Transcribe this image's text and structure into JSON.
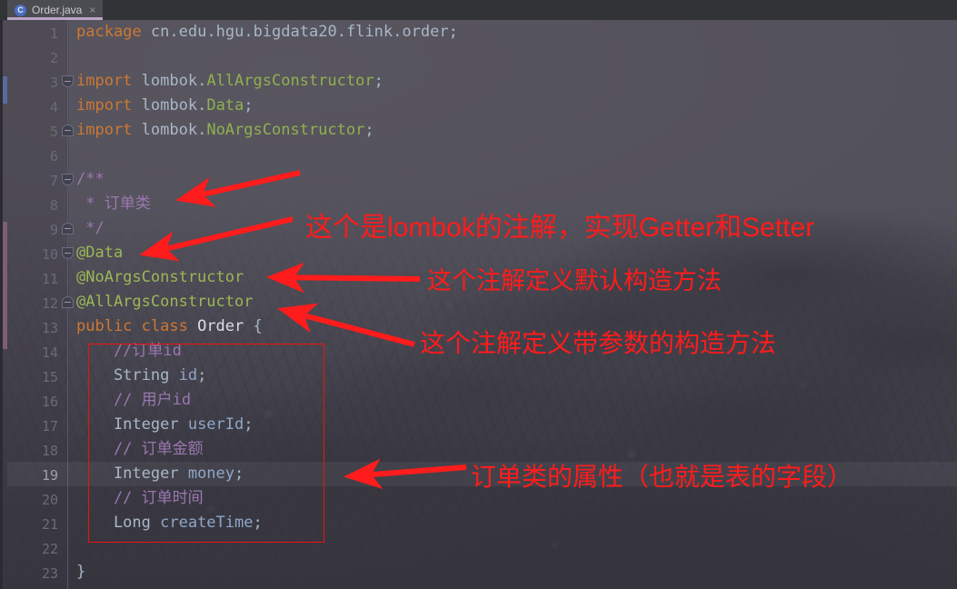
{
  "window": {
    "title": "Order.java"
  },
  "tab": {
    "icon": "java-class-icon",
    "icon_letter": "C",
    "name": "Order.java",
    "close": "×"
  },
  "gutter": {
    "line_numbers": [
      "1",
      "2",
      "3",
      "4",
      "5",
      "6",
      "7",
      "8",
      "9",
      "10",
      "11",
      "12",
      "13",
      "14",
      "15",
      "16",
      "17",
      "18",
      "19",
      "20",
      "21",
      "22",
      "23"
    ],
    "current_line": "19"
  },
  "code": {
    "lines": [
      {
        "n": "1",
        "segments": [
          {
            "t": "package ",
            "c": "kw"
          },
          {
            "t": "cn",
            "c": "pl"
          },
          {
            "t": ".",
            "c": "pun"
          },
          {
            "t": "edu",
            "c": "pl"
          },
          {
            "t": ".",
            "c": "pun"
          },
          {
            "t": "hgu",
            "c": "pl"
          },
          {
            "t": ".",
            "c": "pun"
          },
          {
            "t": "bigdata20",
            "c": "pl"
          },
          {
            "t": ".",
            "c": "pun"
          },
          {
            "t": "flink",
            "c": "pl"
          },
          {
            "t": ".",
            "c": "pun"
          },
          {
            "t": "order",
            "c": "pl"
          },
          {
            "t": ";",
            "c": "pun"
          }
        ]
      },
      {
        "n": "2",
        "segments": []
      },
      {
        "n": "3",
        "segments": [
          {
            "t": "import ",
            "c": "kw"
          },
          {
            "t": "lombok",
            "c": "pl"
          },
          {
            "t": ".",
            "c": "pun"
          },
          {
            "t": "AllArgsConstructor",
            "c": "cls"
          },
          {
            "t": ";",
            "c": "pun"
          }
        ]
      },
      {
        "n": "4",
        "segments": [
          {
            "t": "import ",
            "c": "kw"
          },
          {
            "t": "lombok",
            "c": "pl"
          },
          {
            "t": ".",
            "c": "pun"
          },
          {
            "t": "Data",
            "c": "cls"
          },
          {
            "t": ";",
            "c": "pun"
          }
        ]
      },
      {
        "n": "5",
        "segments": [
          {
            "t": "import ",
            "c": "kw"
          },
          {
            "t": "lombok",
            "c": "pl"
          },
          {
            "t": ".",
            "c": "pun"
          },
          {
            "t": "NoArgsConstructor",
            "c": "cls"
          },
          {
            "t": ";",
            "c": "pun"
          }
        ]
      },
      {
        "n": "6",
        "segments": []
      },
      {
        "n": "7",
        "segments": [
          {
            "t": "/**",
            "c": "cmt"
          }
        ]
      },
      {
        "n": "8",
        "segments": [
          {
            "t": " * 订单类",
            "c": "cmt"
          }
        ]
      },
      {
        "n": "9",
        "segments": [
          {
            "t": " */",
            "c": "cmt"
          }
        ]
      },
      {
        "n": "10",
        "segments": [
          {
            "t": "@Data",
            "c": "anno"
          }
        ]
      },
      {
        "n": "11",
        "segments": [
          {
            "t": "@NoArgsConstructor",
            "c": "anno"
          }
        ]
      },
      {
        "n": "12",
        "segments": [
          {
            "t": "@AllArgsConstructor",
            "c": "anno"
          }
        ]
      },
      {
        "n": "13",
        "segments": [
          {
            "t": "public ",
            "c": "kw"
          },
          {
            "t": "class ",
            "c": "kw"
          },
          {
            "t": "Order",
            "c": "id"
          },
          {
            "t": " {",
            "c": "pun"
          }
        ]
      },
      {
        "n": "14",
        "segments": [
          {
            "t": "    //订单id",
            "c": "cmt"
          }
        ]
      },
      {
        "n": "15",
        "segments": [
          {
            "t": "    String ",
            "c": "pl"
          },
          {
            "t": "id",
            "c": "fld"
          },
          {
            "t": ";",
            "c": "pun"
          }
        ]
      },
      {
        "n": "16",
        "segments": [
          {
            "t": "    // 用户id",
            "c": "cmt"
          }
        ]
      },
      {
        "n": "17",
        "segments": [
          {
            "t": "    Integer ",
            "c": "pl"
          },
          {
            "t": "userId",
            "c": "fld"
          },
          {
            "t": ";",
            "c": "pun"
          }
        ]
      },
      {
        "n": "18",
        "segments": [
          {
            "t": "    // 订单金额",
            "c": "cmt"
          }
        ]
      },
      {
        "n": "19",
        "segments": [
          {
            "t": "    Integer ",
            "c": "pl"
          },
          {
            "t": "money",
            "c": "fld"
          },
          {
            "t": ";",
            "c": "pun"
          }
        ]
      },
      {
        "n": "20",
        "segments": [
          {
            "t": "    // 订单时间",
            "c": "cmt"
          }
        ]
      },
      {
        "n": "21",
        "segments": [
          {
            "t": "    Long ",
            "c": "pl"
          },
          {
            "t": "createTime",
            "c": "fld"
          },
          {
            "t": ";",
            "c": "pun"
          }
        ]
      },
      {
        "n": "22",
        "segments": []
      },
      {
        "n": "23",
        "segments": [
          {
            "t": "}",
            "c": "pun"
          }
        ]
      }
    ]
  },
  "annotations": {
    "color": "#ff1c1c",
    "notes": [
      {
        "id": "note-lombok",
        "text": "这个是lombok的注解，实现Getter和Setter"
      },
      {
        "id": "note-noargs",
        "text": "这个注解定义默认构造方法"
      },
      {
        "id": "note-allargs",
        "text": "这个注解定义带参数的构造方法"
      },
      {
        "id": "note-fields",
        "text": "订单类的属性（也就是表的字段）"
      }
    ]
  }
}
